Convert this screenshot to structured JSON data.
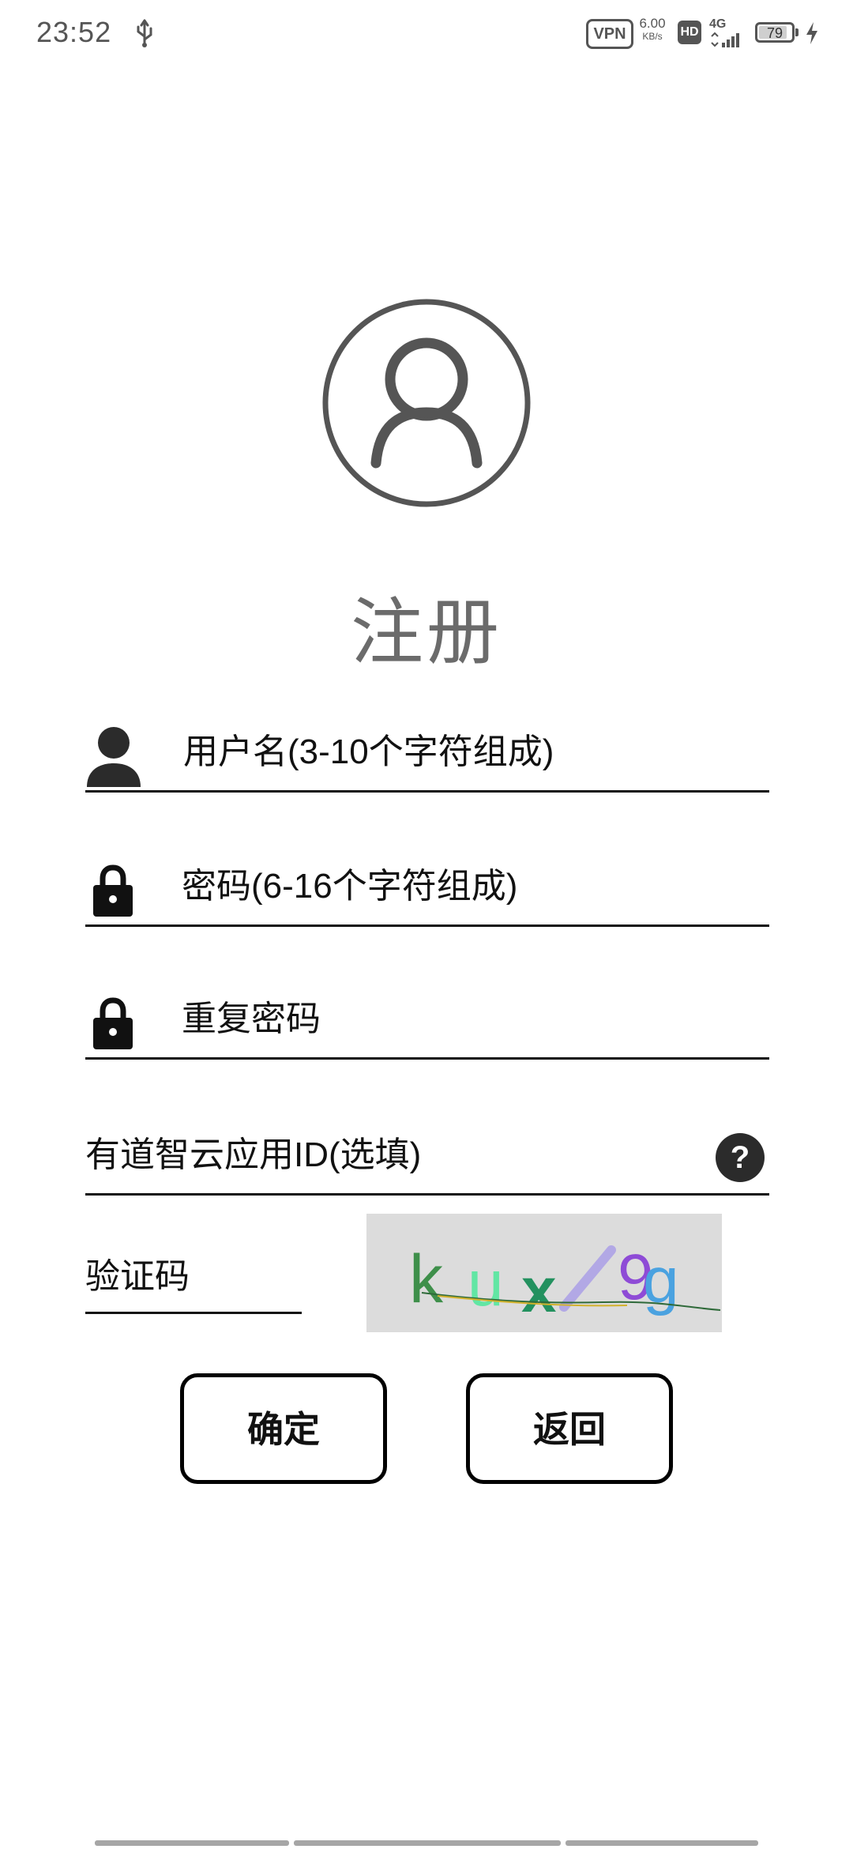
{
  "status_bar": {
    "time": "23:52",
    "vpn": "VPN",
    "net_speed_value": "6.00",
    "net_speed_unit": "KB/s",
    "hd": "HD",
    "network": "4G",
    "battery_level": "79",
    "battery_fraction": 0.79,
    "icons": [
      "usb-icon",
      "signal-icon",
      "battery-icon",
      "charging-icon"
    ]
  },
  "page": {
    "title": "注册",
    "avatar_icon": "user-circle-icon"
  },
  "form": {
    "username": {
      "placeholder": "用户名(3-10个字符组成)",
      "icon": "person-icon"
    },
    "password": {
      "placeholder": "密码(6-16个字符组成)",
      "icon": "lock-icon"
    },
    "repeat_password": {
      "placeholder": "重复密码",
      "icon": "lock-icon"
    },
    "app_id": {
      "placeholder": "有道智云应用ID(选填)",
      "help_icon": "?"
    },
    "captcha": {
      "placeholder": "验证码",
      "image_text": "kux9g"
    }
  },
  "buttons": {
    "confirm": "确定",
    "back": "返回"
  },
  "colors": {
    "title": "#6b6b6b",
    "icon_dark": "#2b2b2b",
    "avatar_stroke": "#555555",
    "captcha_bg": "#dcdcdc"
  }
}
